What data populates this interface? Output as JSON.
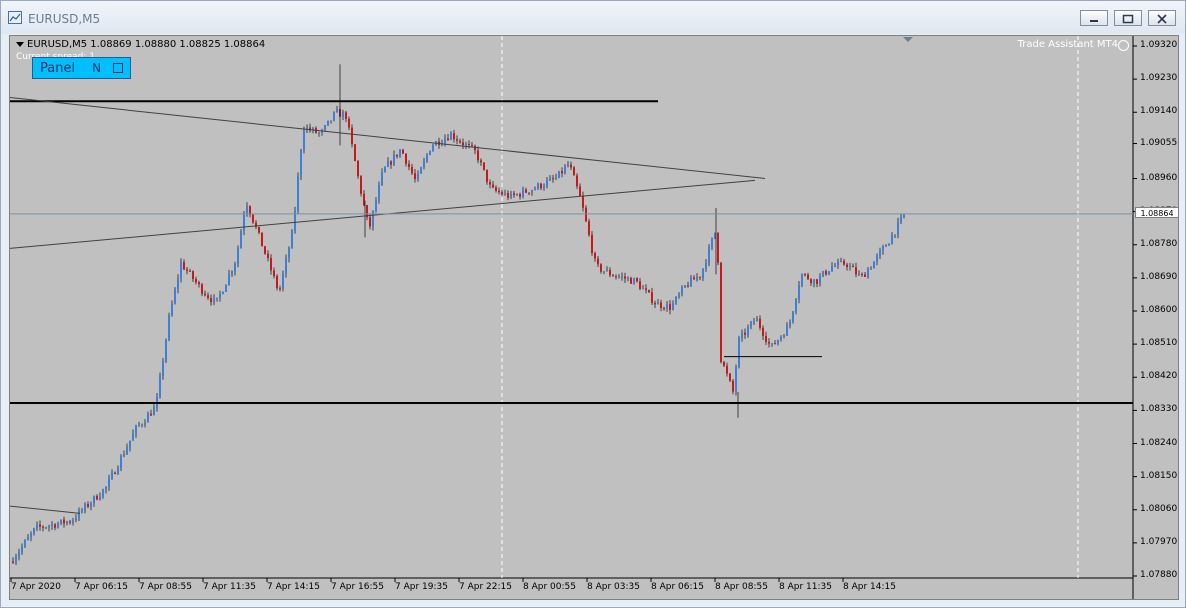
{
  "window": {
    "title": "EURUSD,M5",
    "buttons": [
      "minimize",
      "restore",
      "close"
    ]
  },
  "chart": {
    "symbol_header": "EURUSD,M5  1.08869 1.08880 1.08825 1.08864",
    "spread_text": "Current spread: 1",
    "panel": {
      "label": "Panel",
      "mode": "N"
    },
    "indicator_label": "Trade Assistant MT4",
    "current_price": "1.08864",
    "price_levels": [
      "1.09320",
      "1.09230",
      "1.09140",
      "1.09055",
      "1.08960",
      "1.08870",
      "1.08780",
      "1.08690",
      "1.08600",
      "1.08510",
      "1.08420",
      "1.08330",
      "1.08240",
      "1.08150",
      "1.08060",
      "1.07970",
      "1.07880"
    ],
    "time_labels": [
      "7 Apr 2020",
      "7 Apr 06:15",
      "7 Apr 08:55",
      "7 Apr 11:35",
      "7 Apr 14:15",
      "7 Apr 16:55",
      "7 Apr 19:35",
      "7 Apr 22:15",
      "8 Apr 00:55",
      "8 Apr 03:35",
      "8 Apr 06:15",
      "8 Apr 08:55",
      "8 Apr 11:35",
      "8 Apr 14:15"
    ],
    "colors": {
      "background": "#c0c0c0",
      "bull": "#3d7fd9",
      "bear": "#c8181c",
      "wick": "#202020"
    }
  }
}
